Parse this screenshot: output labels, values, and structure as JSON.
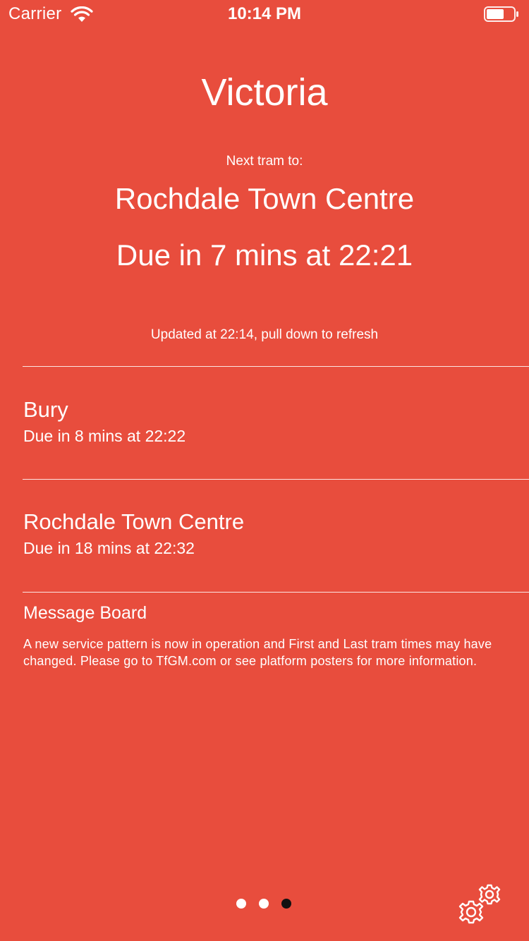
{
  "status_bar": {
    "carrier": "Carrier",
    "time": "10:14 PM"
  },
  "station": {
    "name": "Victoria"
  },
  "next_tram": {
    "label": "Next tram to:",
    "destination": "Rochdale Town Centre",
    "due": "Due in 7 mins at 22:21"
  },
  "updated_text": "Updated at 22:14, pull down to refresh",
  "departures": [
    {
      "destination": "Bury",
      "due": "Due in 8 mins at 22:22"
    },
    {
      "destination": "Rochdale Town Centre",
      "due": "Due in 18 mins at 22:32"
    }
  ],
  "message_board": {
    "title": "Message Board",
    "text": "A new service pattern is now in operation and First and Last tram times may have changed. Please go to TfGM.com or see platform posters for more information."
  },
  "pager": {
    "total_pages": 3,
    "current_page": 3
  },
  "icons": {
    "wifi": "wifi-icon",
    "battery": "battery-icon",
    "settings": "gear-icon"
  },
  "colors": {
    "background": "#e84d3d",
    "text": "#ffffff",
    "active_dot": "#111111"
  }
}
